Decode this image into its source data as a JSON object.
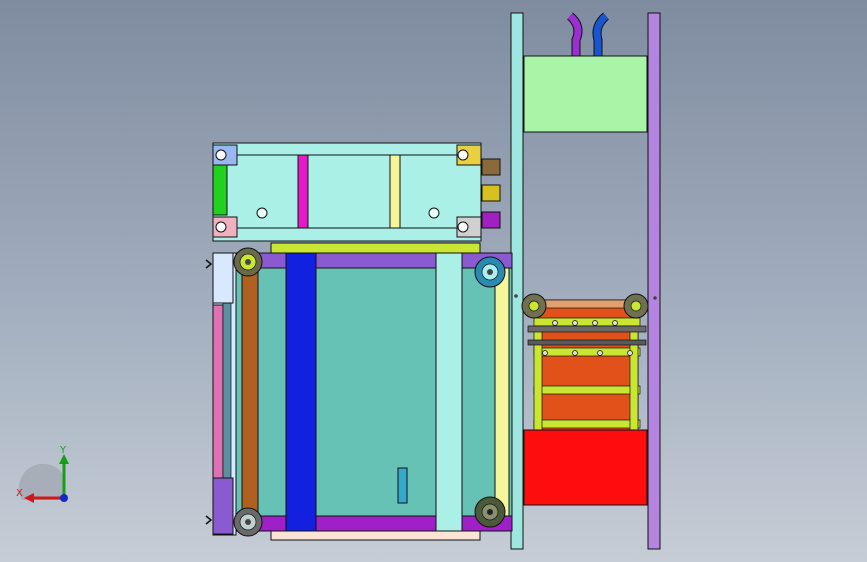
{
  "view": {
    "background_top": "#7f8ca0",
    "background_bottom": "#c6cdd6",
    "model_parts": [
      "upper-module",
      "main-frame",
      "vertical-rails",
      "side-rack",
      "top-box",
      "red-base-block",
      "hoses"
    ]
  },
  "triad": {
    "x_label": "X",
    "y_label": "Y",
    "x_color": "#d01818",
    "y_color": "#14a014",
    "z_color": "#1428c8"
  },
  "colors": {
    "cyan_panel": "#aaf0e6",
    "teal_panel": "#66c2b4",
    "blue_bar": "#1220e0",
    "magenta": "#e619c8",
    "purple": "#8a30c8",
    "lavender": "#b485e0",
    "light_green": "#a8f5a8",
    "red": "#ff0d0d",
    "orange": "#e0521a",
    "yellow_green": "#c8e632",
    "light_cyan_rail": "#9ee6e0",
    "pink": "#e070b4",
    "brown": "#b06020"
  }
}
